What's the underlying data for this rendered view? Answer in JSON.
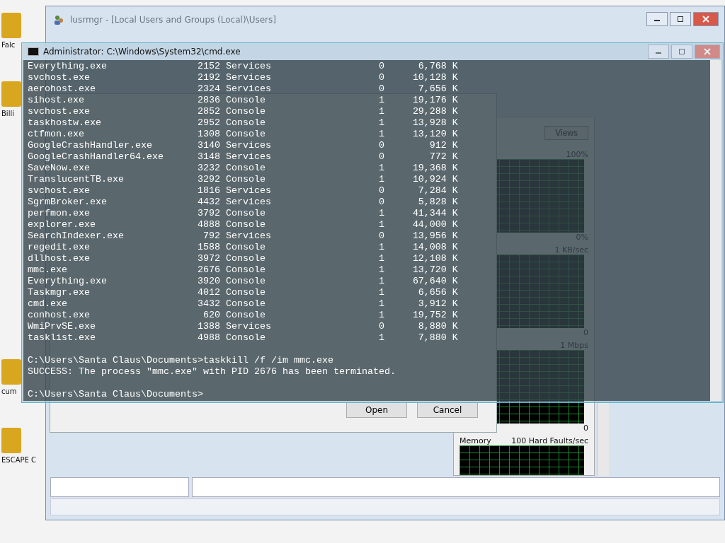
{
  "desktop_icons": [
    {
      "label": "Falc"
    },
    {
      "label": "Billi"
    },
    {
      "label": "cum"
    },
    {
      "label": "ESCAPE C"
    }
  ],
  "lusrmgr_window": {
    "title": "lusrmgr - [Local Users and Groups (Local)\\Users]"
  },
  "resource_monitor": {
    "views_button": "Views",
    "graphs": [
      {
        "top_label": "100%",
        "bottom_label": "0%"
      },
      {
        "top_label": "1 KB/sec",
        "bottom_label": "0"
      },
      {
        "top_label": "1 Mbps",
        "bottom_label": "0"
      },
      {
        "title": "Memory",
        "top_label": "100 Hard Faults/sec"
      }
    ]
  },
  "open_dialog": {
    "buttons": [
      "Open",
      "Cancel"
    ]
  },
  "cmd_window": {
    "title": "Administrator: C:\\Windows\\System32\\cmd.exe",
    "rows": [
      {
        "name": "Everything.exe",
        "pid": "2152",
        "session": "Services",
        "session_no": "0",
        "mem": "6,768 K"
      },
      {
        "name": "svchost.exe",
        "pid": "2192",
        "session": "Services",
        "session_no": "0",
        "mem": "10,128 K"
      },
      {
        "name": "aerohost.exe",
        "pid": "2324",
        "session": "Services",
        "session_no": "0",
        "mem": "7,656 K"
      },
      {
        "name": "sihost.exe",
        "pid": "2836",
        "session": "Console",
        "session_no": "1",
        "mem": "19,176 K"
      },
      {
        "name": "svchost.exe",
        "pid": "2852",
        "session": "Console",
        "session_no": "1",
        "mem": "29,288 K"
      },
      {
        "name": "taskhostw.exe",
        "pid": "2952",
        "session": "Console",
        "session_no": "1",
        "mem": "13,928 K"
      },
      {
        "name": "ctfmon.exe",
        "pid": "1308",
        "session": "Console",
        "session_no": "1",
        "mem": "13,120 K"
      },
      {
        "name": "GoogleCrashHandler.exe",
        "pid": "3140",
        "session": "Services",
        "session_no": "0",
        "mem": "912 K"
      },
      {
        "name": "GoogleCrashHandler64.exe",
        "pid": "3148",
        "session": "Services",
        "session_no": "0",
        "mem": "772 K"
      },
      {
        "name": "SaveNow.exe",
        "pid": "3232",
        "session": "Console",
        "session_no": "1",
        "mem": "19,368 K"
      },
      {
        "name": "TranslucentTB.exe",
        "pid": "3292",
        "session": "Console",
        "session_no": "1",
        "mem": "10,924 K"
      },
      {
        "name": "svchost.exe",
        "pid": "1816",
        "session": "Services",
        "session_no": "0",
        "mem": "7,284 K"
      },
      {
        "name": "SgrmBroker.exe",
        "pid": "4432",
        "session": "Services",
        "session_no": "0",
        "mem": "5,828 K"
      },
      {
        "name": "perfmon.exe",
        "pid": "3792",
        "session": "Console",
        "session_no": "1",
        "mem": "41,344 K"
      },
      {
        "name": "explorer.exe",
        "pid": "4888",
        "session": "Console",
        "session_no": "1",
        "mem": "44,000 K"
      },
      {
        "name": "SearchIndexer.exe",
        "pid": "792",
        "session": "Services",
        "session_no": "0",
        "mem": "13,956 K"
      },
      {
        "name": "regedit.exe",
        "pid": "1588",
        "session": "Console",
        "session_no": "1",
        "mem": "14,008 K"
      },
      {
        "name": "dllhost.exe",
        "pid": "3972",
        "session": "Console",
        "session_no": "1",
        "mem": "12,108 K"
      },
      {
        "name": "mmc.exe",
        "pid": "2676",
        "session": "Console",
        "session_no": "1",
        "mem": "13,720 K"
      },
      {
        "name": "Everything.exe",
        "pid": "3920",
        "session": "Console",
        "session_no": "1",
        "mem": "67,640 K"
      },
      {
        "name": "Taskmgr.exe",
        "pid": "4012",
        "session": "Console",
        "session_no": "1",
        "mem": "6,656 K"
      },
      {
        "name": "cmd.exe",
        "pid": "3432",
        "session": "Console",
        "session_no": "1",
        "mem": "3,912 K"
      },
      {
        "name": "conhost.exe",
        "pid": "620",
        "session": "Console",
        "session_no": "1",
        "mem": "19,752 K"
      },
      {
        "name": "WmiPrvSE.exe",
        "pid": "1388",
        "session": "Services",
        "session_no": "0",
        "mem": "8,880 K"
      },
      {
        "name": "tasklist.exe",
        "pid": "4988",
        "session": "Console",
        "session_no": "1",
        "mem": "7,880 K"
      }
    ],
    "output": [
      "C:\\Users\\Santa Claus\\Documents>taskkill /f /im mmc.exe",
      "SUCCESS: The process \"mmc.exe\" with PID 2676 has been terminated."
    ],
    "prompt": "C:\\Users\\Santa Claus\\Documents>"
  }
}
